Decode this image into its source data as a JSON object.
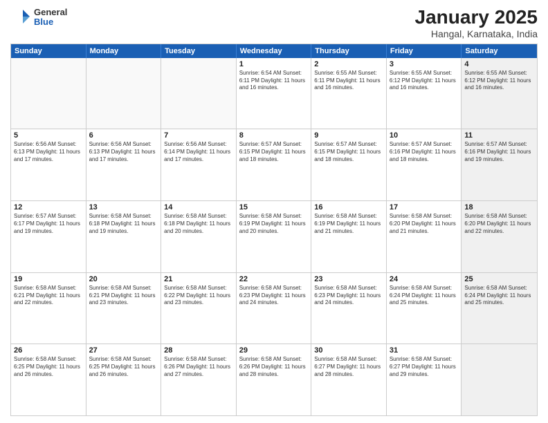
{
  "logo": {
    "general": "General",
    "blue": "Blue"
  },
  "header": {
    "title": "January 2025",
    "subtitle": "Hangal, Karnataka, India"
  },
  "weekdays": [
    "Sunday",
    "Monday",
    "Tuesday",
    "Wednesday",
    "Thursday",
    "Friday",
    "Saturday"
  ],
  "rows": [
    [
      {
        "day": "",
        "info": "",
        "empty": true
      },
      {
        "day": "",
        "info": "",
        "empty": true
      },
      {
        "day": "",
        "info": "",
        "empty": true
      },
      {
        "day": "1",
        "info": "Sunrise: 6:54 AM\nSunset: 6:11 PM\nDaylight: 11 hours\nand 16 minutes."
      },
      {
        "day": "2",
        "info": "Sunrise: 6:55 AM\nSunset: 6:11 PM\nDaylight: 11 hours\nand 16 minutes."
      },
      {
        "day": "3",
        "info": "Sunrise: 6:55 AM\nSunset: 6:12 PM\nDaylight: 11 hours\nand 16 minutes."
      },
      {
        "day": "4",
        "info": "Sunrise: 6:55 AM\nSunset: 6:12 PM\nDaylight: 11 hours\nand 16 minutes.",
        "shaded": true
      }
    ],
    [
      {
        "day": "5",
        "info": "Sunrise: 6:56 AM\nSunset: 6:13 PM\nDaylight: 11 hours\nand 17 minutes."
      },
      {
        "day": "6",
        "info": "Sunrise: 6:56 AM\nSunset: 6:13 PM\nDaylight: 11 hours\nand 17 minutes."
      },
      {
        "day": "7",
        "info": "Sunrise: 6:56 AM\nSunset: 6:14 PM\nDaylight: 11 hours\nand 17 minutes."
      },
      {
        "day": "8",
        "info": "Sunrise: 6:57 AM\nSunset: 6:15 PM\nDaylight: 11 hours\nand 18 minutes."
      },
      {
        "day": "9",
        "info": "Sunrise: 6:57 AM\nSunset: 6:15 PM\nDaylight: 11 hours\nand 18 minutes."
      },
      {
        "day": "10",
        "info": "Sunrise: 6:57 AM\nSunset: 6:16 PM\nDaylight: 11 hours\nand 18 minutes."
      },
      {
        "day": "11",
        "info": "Sunrise: 6:57 AM\nSunset: 6:16 PM\nDaylight: 11 hours\nand 19 minutes.",
        "shaded": true
      }
    ],
    [
      {
        "day": "12",
        "info": "Sunrise: 6:57 AM\nSunset: 6:17 PM\nDaylight: 11 hours\nand 19 minutes."
      },
      {
        "day": "13",
        "info": "Sunrise: 6:58 AM\nSunset: 6:18 PM\nDaylight: 11 hours\nand 19 minutes."
      },
      {
        "day": "14",
        "info": "Sunrise: 6:58 AM\nSunset: 6:18 PM\nDaylight: 11 hours\nand 20 minutes."
      },
      {
        "day": "15",
        "info": "Sunrise: 6:58 AM\nSunset: 6:19 PM\nDaylight: 11 hours\nand 20 minutes."
      },
      {
        "day": "16",
        "info": "Sunrise: 6:58 AM\nSunset: 6:19 PM\nDaylight: 11 hours\nand 21 minutes."
      },
      {
        "day": "17",
        "info": "Sunrise: 6:58 AM\nSunset: 6:20 PM\nDaylight: 11 hours\nand 21 minutes."
      },
      {
        "day": "18",
        "info": "Sunrise: 6:58 AM\nSunset: 6:20 PM\nDaylight: 11 hours\nand 22 minutes.",
        "shaded": true
      }
    ],
    [
      {
        "day": "19",
        "info": "Sunrise: 6:58 AM\nSunset: 6:21 PM\nDaylight: 11 hours\nand 22 minutes."
      },
      {
        "day": "20",
        "info": "Sunrise: 6:58 AM\nSunset: 6:21 PM\nDaylight: 11 hours\nand 23 minutes."
      },
      {
        "day": "21",
        "info": "Sunrise: 6:58 AM\nSunset: 6:22 PM\nDaylight: 11 hours\nand 23 minutes."
      },
      {
        "day": "22",
        "info": "Sunrise: 6:58 AM\nSunset: 6:23 PM\nDaylight: 11 hours\nand 24 minutes."
      },
      {
        "day": "23",
        "info": "Sunrise: 6:58 AM\nSunset: 6:23 PM\nDaylight: 11 hours\nand 24 minutes."
      },
      {
        "day": "24",
        "info": "Sunrise: 6:58 AM\nSunset: 6:24 PM\nDaylight: 11 hours\nand 25 minutes."
      },
      {
        "day": "25",
        "info": "Sunrise: 6:58 AM\nSunset: 6:24 PM\nDaylight: 11 hours\nand 25 minutes.",
        "shaded": true
      }
    ],
    [
      {
        "day": "26",
        "info": "Sunrise: 6:58 AM\nSunset: 6:25 PM\nDaylight: 11 hours\nand 26 minutes."
      },
      {
        "day": "27",
        "info": "Sunrise: 6:58 AM\nSunset: 6:25 PM\nDaylight: 11 hours\nand 26 minutes."
      },
      {
        "day": "28",
        "info": "Sunrise: 6:58 AM\nSunset: 6:26 PM\nDaylight: 11 hours\nand 27 minutes."
      },
      {
        "day": "29",
        "info": "Sunrise: 6:58 AM\nSunset: 6:26 PM\nDaylight: 11 hours\nand 28 minutes."
      },
      {
        "day": "30",
        "info": "Sunrise: 6:58 AM\nSunset: 6:27 PM\nDaylight: 11 hours\nand 28 minutes."
      },
      {
        "day": "31",
        "info": "Sunrise: 6:58 AM\nSunset: 6:27 PM\nDaylight: 11 hours\nand 29 minutes."
      },
      {
        "day": "",
        "info": "",
        "empty": true,
        "shaded": true
      }
    ]
  ]
}
